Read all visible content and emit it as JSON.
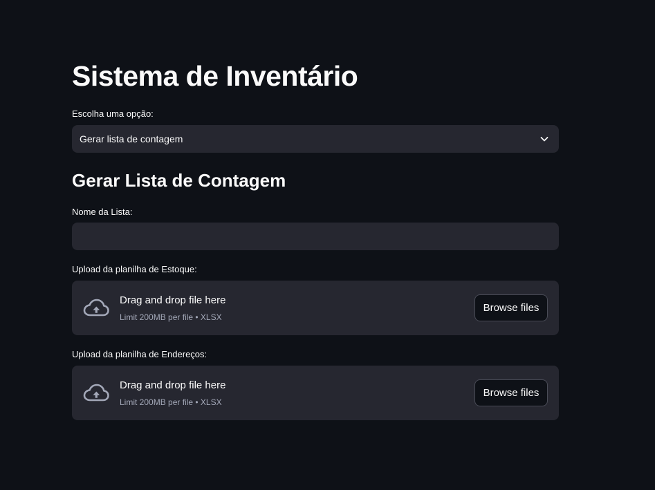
{
  "page": {
    "title": "Sistema de Inventário"
  },
  "option_select": {
    "label": "Escolha uma opção:",
    "value": "Gerar lista de contagem"
  },
  "section": {
    "title": "Gerar Lista de Contagem"
  },
  "list_name": {
    "label": "Nome da Lista:",
    "value": ""
  },
  "uploads": [
    {
      "label": "Upload da planilha de Estoque:",
      "drop_text": "Drag and drop file here",
      "limit_text": "Limit 200MB per file • XLSX",
      "button_label": "Browse files"
    },
    {
      "label": "Upload da planilha de Endereços:",
      "drop_text": "Drag and drop file here",
      "limit_text": "Limit 200MB per file • XLSX",
      "button_label": "Browse files"
    }
  ],
  "colors": {
    "background": "#0e1117",
    "widget_background": "#262730",
    "text": "#fafafa",
    "muted_text": "#a3a8b8",
    "button_border": "#4a4c57"
  },
  "icons": {
    "select_chevron": "chevron-down-icon",
    "upload": "cloud-upload-icon"
  }
}
